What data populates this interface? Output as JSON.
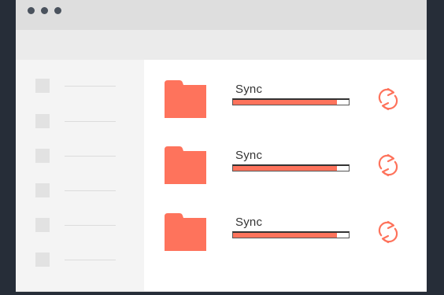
{
  "colors": {
    "accent": "#fe735c",
    "background": "#262d38",
    "titlebar": "#dedede",
    "sidebar": "#f4f4f4"
  },
  "sidebar": {
    "items": [
      {
        "icon": "placeholder-square"
      },
      {
        "icon": "placeholder-square"
      },
      {
        "icon": "placeholder-square"
      },
      {
        "icon": "placeholder-square"
      },
      {
        "icon": "placeholder-square"
      },
      {
        "icon": "placeholder-square"
      }
    ]
  },
  "folders": [
    {
      "label": "Sync",
      "progress": 0.9,
      "icon": "folder-icon",
      "action_icon": "sync-icon"
    },
    {
      "label": "Sync",
      "progress": 0.9,
      "icon": "folder-icon",
      "action_icon": "sync-icon"
    },
    {
      "label": "Sync",
      "progress": 0.9,
      "icon": "folder-icon",
      "action_icon": "sync-icon"
    }
  ]
}
